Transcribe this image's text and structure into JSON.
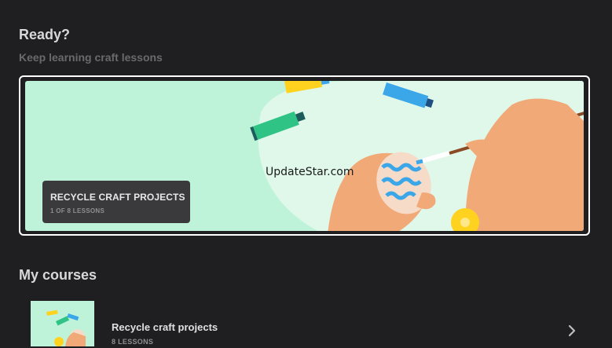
{
  "header": {
    "title": "Ready?",
    "subtitle": "Keep learning craft lessons"
  },
  "hero": {
    "watermark": "UpdateStar.com",
    "card_title": "RECYCLE CRAFT PROJECTS",
    "card_progress": "1 OF 8 LESSONS",
    "illustration_icon": "egg-painting-illustration"
  },
  "my_courses": {
    "heading": "My courses",
    "items": [
      {
        "title": "Recycle craft projects",
        "lessons": "8 LESSONS",
        "chevron_icon": "chevron-right-icon"
      }
    ]
  },
  "colors": {
    "background": "#1f1f21",
    "hero_bg": "#bff3d9",
    "card_bg": "#3a3a3c",
    "accent_yellow": "#ffd21f",
    "accent_blue": "#3ba6e8"
  }
}
